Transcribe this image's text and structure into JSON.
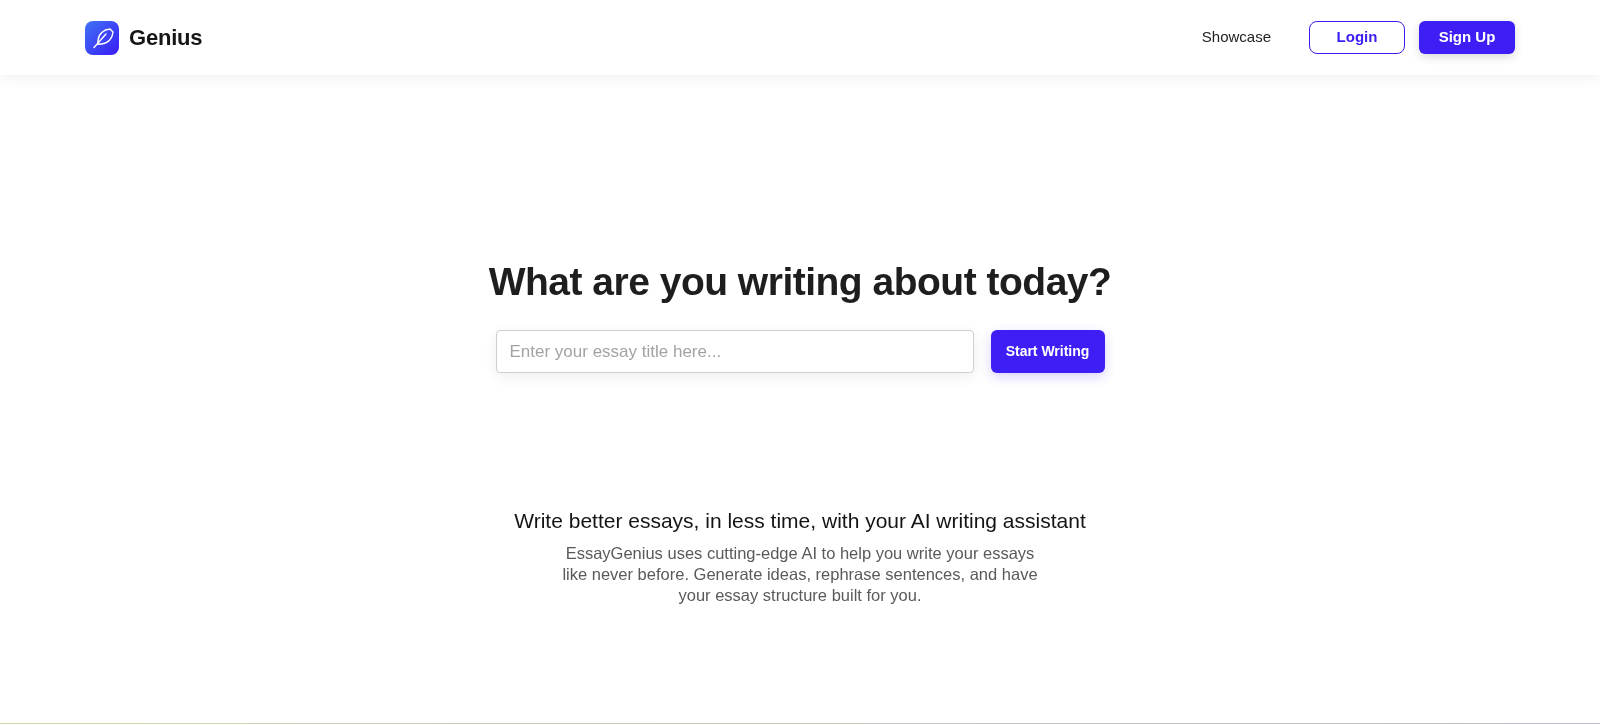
{
  "header": {
    "logo": {
      "text": "Genius"
    },
    "nav": [
      {
        "label": "Showcase",
        "kind": "link"
      },
      {
        "label": "Login",
        "kind": "outline"
      },
      {
        "label": "Sign Up",
        "kind": "primary"
      }
    ]
  },
  "hero": {
    "title": "What are you writing about today?",
    "input": {
      "placeholder": "Enter your essay title here..."
    },
    "button": "Start Writing"
  },
  "intro": {
    "heading": "Write better essays, in less time, with your AI writing assistant",
    "body": "EssayGenius uses cutting-edge AI to help you write your essays like never before. Generate ideas, rephrase sentences, and have your essay structure built for you."
  }
}
